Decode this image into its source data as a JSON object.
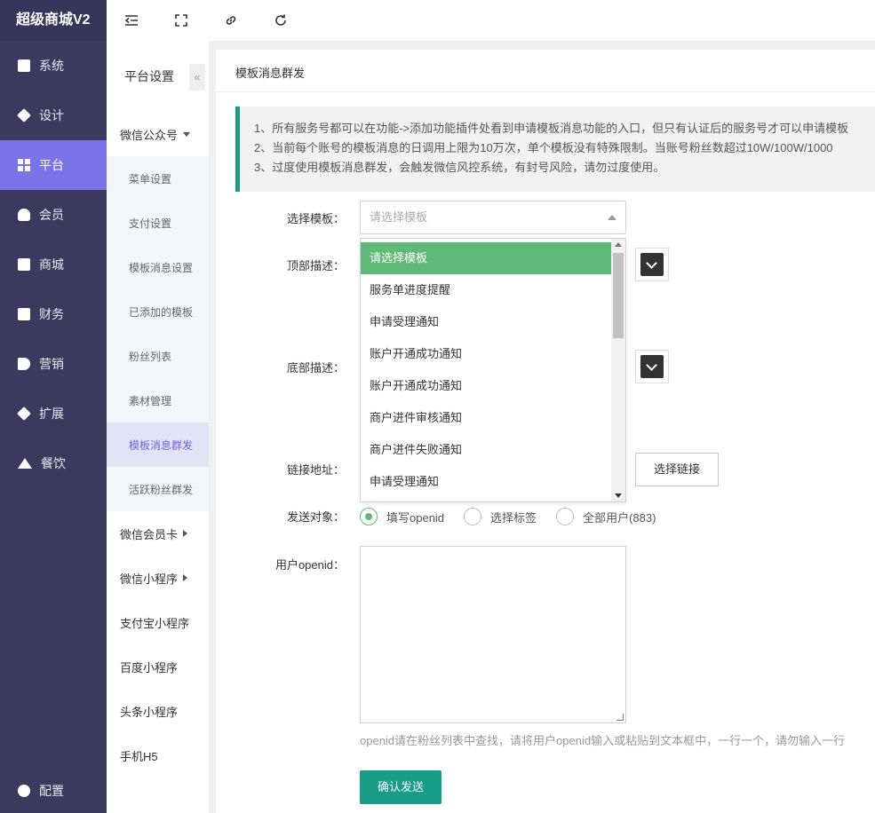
{
  "app": {
    "title": "超级商城V2"
  },
  "nav": {
    "items": [
      {
        "label": "系统",
        "icon": "system-icon"
      },
      {
        "label": "设计",
        "icon": "design-icon"
      },
      {
        "label": "平台",
        "icon": "platform-icon"
      },
      {
        "label": "会员",
        "icon": "member-icon"
      },
      {
        "label": "商城",
        "icon": "mall-icon"
      },
      {
        "label": "财务",
        "icon": "finance-icon"
      },
      {
        "label": "营销",
        "icon": "marketing-icon"
      },
      {
        "label": "扩展",
        "icon": "extension-icon"
      },
      {
        "label": "餐饮",
        "icon": "catering-icon"
      }
    ],
    "active": "平台",
    "bottom": {
      "label": "配置",
      "icon": "gear-icon"
    }
  },
  "toolbar": {
    "icons": [
      "indent-icon",
      "fullscreen-icon",
      "link-icon",
      "refresh-icon"
    ]
  },
  "subnav": {
    "title": "平台设置",
    "collapse_glyph": "«",
    "groups": {
      "wechat_oa": "微信公众号",
      "wechat_card": "微信会员卡",
      "wechat_mini": "微信小程序",
      "alipay_mini": "支付宝小程序",
      "baidu_mini": "百度小程序",
      "toutiao_mini": "头条小程序",
      "h5": "手机H5"
    },
    "wechat_items": [
      "菜单设置",
      "支付设置",
      "模板消息设置",
      "已添加的模板",
      "粉丝列表",
      "素材管理",
      "模板消息群发",
      "活跃粉丝群发"
    ],
    "active": "模板消息群发"
  },
  "main": {
    "title": "模板消息群发",
    "notice": [
      "1、所有服务号都可以在功能->添加功能插件处看到申请模板消息功能的入口，但只有认证后的服务号才可以申请模板",
      "2、当前每个账号的模板消息的日调用上限为10万次，单个模板没有特殊限制。当账号粉丝数超过10W/100W/1000",
      "3、过度使用模板消息群发，会触发微信风控系统，有封号风险，请勿过度使用。"
    ],
    "form": {
      "template_label": "选择模板：",
      "template_placeholder": "请选择模板",
      "top_desc_label": "顶部描述：",
      "bottom_desc_label": "底部描述：",
      "link_label": "链接地址：",
      "link_button": "选择链接",
      "target_label": "发送对象：",
      "target_options": [
        "填写openid",
        "选择标签",
        "全部用户(883)"
      ],
      "target_selected": "填写openid",
      "openid_label": "用户openid：",
      "openid_hint": "openid请在粉丝列表中查找，请将用户openid输入或粘贴到文本框中，一行一个，请勿输入一行",
      "submit": "确认发送"
    },
    "dropdown": {
      "options": [
        "请选择模板",
        "服务单进度提醒",
        "申请受理通知",
        "账户开通成功通知",
        "账户开通成功通知",
        "商户进件审核通知",
        "商户进件失败通知",
        "申请受理通知"
      ],
      "highlighted": "请选择模板"
    }
  },
  "colors": {
    "sidebar": "#3b3a5e",
    "nav_active": "#7a74e8",
    "accent_green": "#169c87",
    "option_selected": "#5fba77",
    "sub_active_text": "#6b64d8"
  }
}
